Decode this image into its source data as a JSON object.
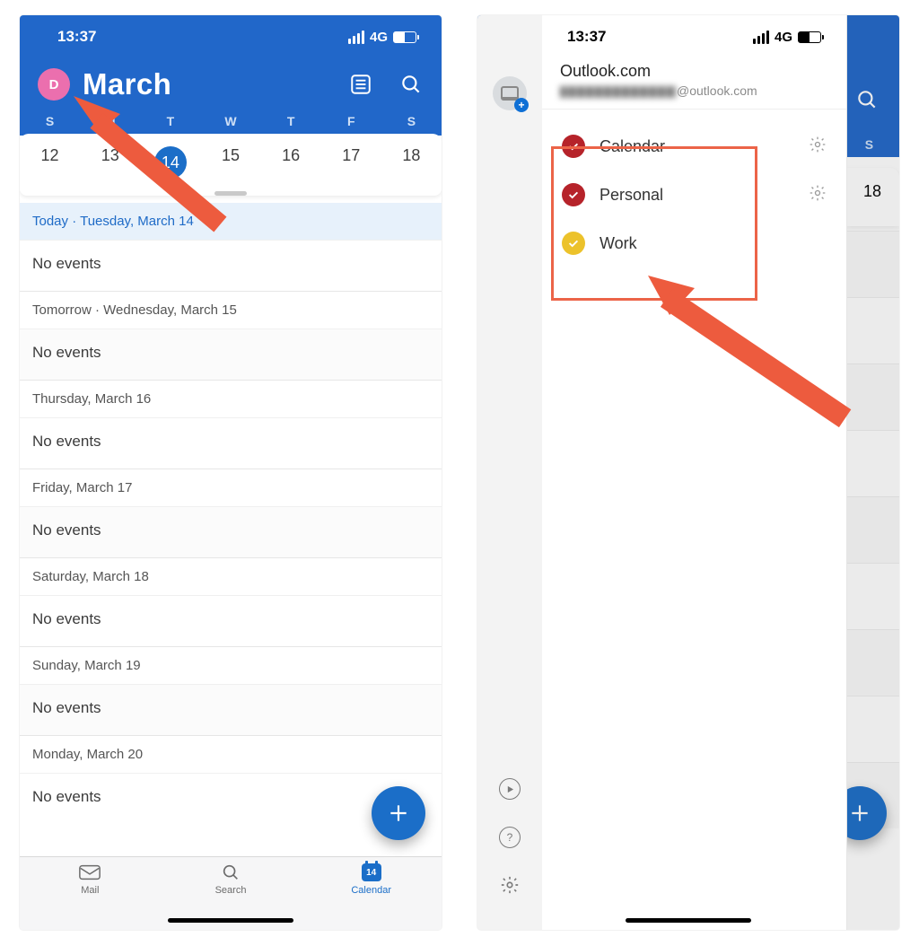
{
  "status": {
    "time": "13:37",
    "network": "4G"
  },
  "left": {
    "avatar_letter": "D",
    "month": "March",
    "weekday_labels": [
      "S",
      "M",
      "T",
      "W",
      "T",
      "F",
      "S"
    ],
    "week_dates": [
      12,
      13,
      14,
      15,
      16,
      17,
      18
    ],
    "selected_date": 14,
    "agenda": [
      {
        "header": "Today · Tuesday, March 14",
        "today": true,
        "body": "No events"
      },
      {
        "header": "Tomorrow · Wednesday, March 15",
        "body": "No events"
      },
      {
        "header": "Thursday, March 16",
        "body": "No events"
      },
      {
        "header": "Friday, March 17",
        "body": "No events"
      },
      {
        "header": "Saturday, March 18",
        "body": "No events"
      },
      {
        "header": "Sunday, March 19",
        "body": "No events"
      },
      {
        "header": "Monday, March 20",
        "body": "No events"
      }
    ],
    "tabs": {
      "mail": "Mail",
      "search": "Search",
      "calendar": "Calendar",
      "calendar_date": "14"
    }
  },
  "right": {
    "account_title": "Outlook.com",
    "account_email_suffix": "@outlook.com",
    "calendars": [
      {
        "name": "Calendar",
        "color": "red",
        "gear": true
      },
      {
        "name": "Personal",
        "color": "red",
        "gear": true
      },
      {
        "name": "Work",
        "color": "yellow",
        "gear": false
      }
    ],
    "visible_weekday": "S",
    "visible_date": 18
  }
}
